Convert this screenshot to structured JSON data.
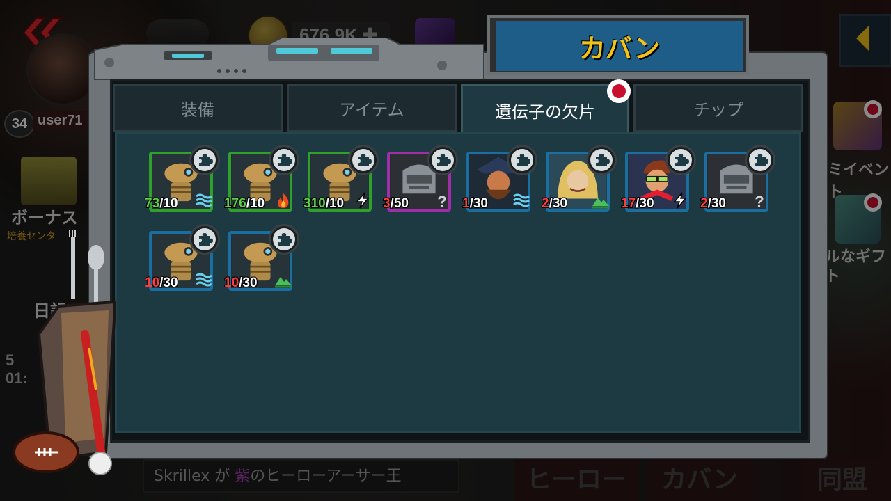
{
  "background": {
    "player": {
      "level": "34",
      "username": "user71"
    },
    "currency": {
      "coins": "676.9K"
    },
    "side_left": {
      "bonus": "ボーナス",
      "bonus_sub": "培養センタ",
      "diary": "日記"
    },
    "side_right": {
      "event": "ミイベント",
      "gift": "ルなギフト"
    },
    "chat": {
      "name": "Skrillex",
      "pre": "が",
      "rarity": "紫",
      "rest": "のヒーローアーサー王"
    },
    "bottom_buttons": [
      "ヒーロー",
      "カバン",
      "同盟"
    ]
  },
  "bag": {
    "title": "カバン",
    "tabs": [
      {
        "label": "装備",
        "active": false
      },
      {
        "label": "アイテム",
        "active": false
      },
      {
        "label": "遺伝子の欠片",
        "active": true,
        "notification": true
      },
      {
        "label": "チップ",
        "active": false
      }
    ],
    "fragments": [
      {
        "owned": "73",
        "total": "/10",
        "owned_color": "green",
        "rarity_color": "#2fa02a",
        "art": "robot",
        "element": "water-icon"
      },
      {
        "owned": "176",
        "total": "/10",
        "owned_color": "green",
        "rarity_color": "#2fa02a",
        "art": "robot",
        "element": "fire-icon"
      },
      {
        "owned": "310",
        "total": "/10",
        "owned_color": "green",
        "rarity_color": "#2fa02a",
        "art": "robot",
        "element": "lightning-icon"
      },
      {
        "owned": "3",
        "total": "/50",
        "owned_color": "red",
        "rarity_color": "#a02ea8",
        "art": "unknown",
        "element": "question-icon"
      },
      {
        "owned": "1",
        "total": "/30",
        "owned_color": "red",
        "rarity_color": "#1a6ea0",
        "art": "pirate",
        "element": "water-icon"
      },
      {
        "owned": "2",
        "total": "/30",
        "owned_color": "red",
        "rarity_color": "#1a6ea0",
        "art": "rocker",
        "element": "earth-icon"
      },
      {
        "owned": "17",
        "total": "/30",
        "owned_color": "red",
        "rarity_color": "#1a6ea0",
        "art": "dj",
        "element": "lightning-icon"
      },
      {
        "owned": "2",
        "total": "/30",
        "owned_color": "red",
        "rarity_color": "#1a6ea0",
        "art": "unknown",
        "element": "question-icon"
      },
      {
        "owned": "10",
        "total": "/30",
        "owned_color": "red",
        "rarity_color": "#1a6ea0",
        "art": "robot",
        "element": "water-icon"
      },
      {
        "owned": "10",
        "total": "/30",
        "owned_color": "red",
        "rarity_color": "#1a6ea0",
        "art": "robot",
        "element": "earth-icon"
      }
    ]
  }
}
